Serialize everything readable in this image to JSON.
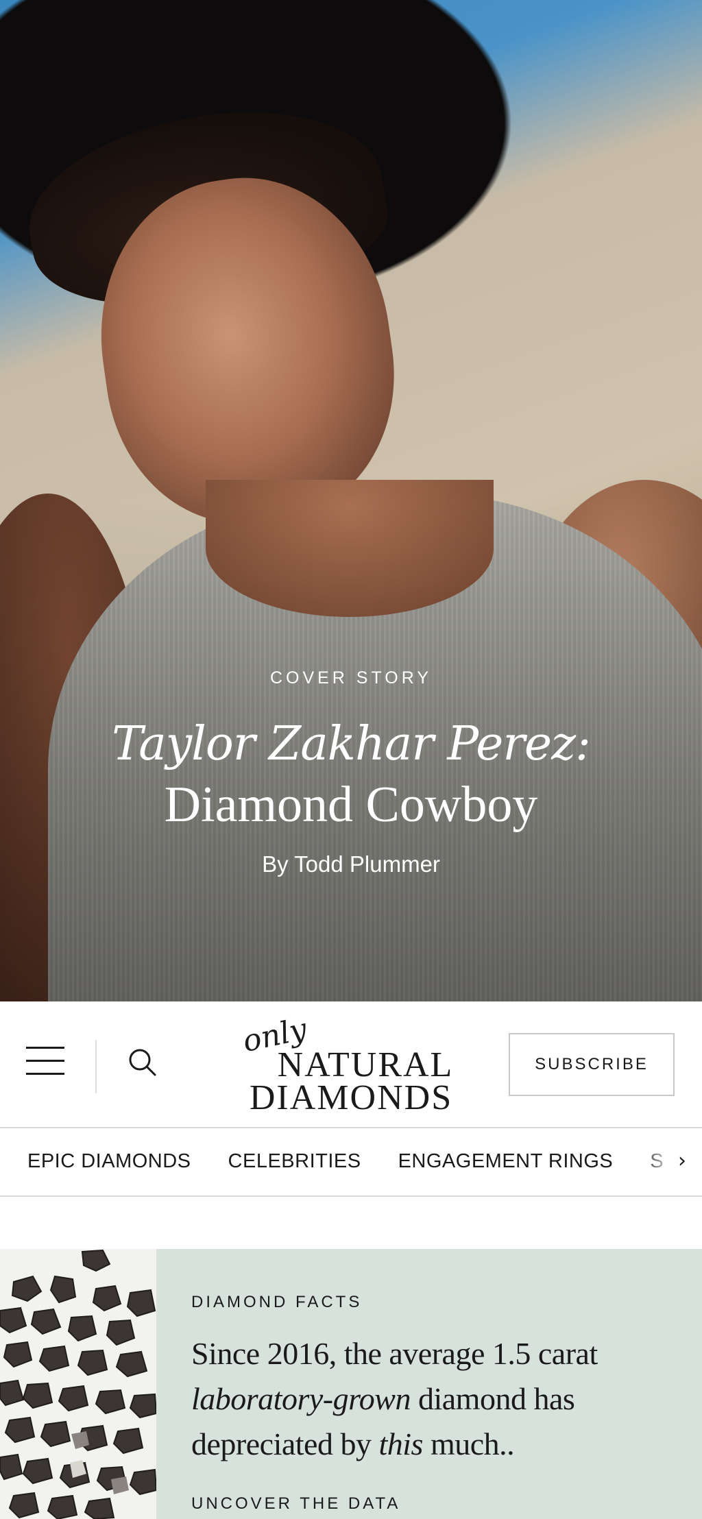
{
  "hero": {
    "kicker": "COVER STORY",
    "title_line1": "Taylor Zakhar Perez:",
    "title_line2": "Diamond Cowboy",
    "byline": "By Todd Plummer"
  },
  "header": {
    "logo_script": "only",
    "logo_line1": "NATURAL",
    "logo_line2": "DIAMONDS",
    "subscribe_label": "SUBSCRIBE"
  },
  "nav": {
    "items": [
      {
        "label": "EPIC DIAMONDS"
      },
      {
        "label": "CELEBRITIES"
      },
      {
        "label": "ENGAGEMENT RINGS"
      },
      {
        "label": "S"
      }
    ]
  },
  "card": {
    "kicker": "DIAMOND FACTS",
    "headline_part1": "Since 2016, the average 1.5 carat ",
    "headline_italic1": "laboratory-grown",
    "headline_part2": " diamond has depreciated by ",
    "headline_italic2": "this",
    "headline_part3": " much..",
    "cta": "UNCOVER THE DATA"
  },
  "icons": [
    "menu-icon",
    "search-icon",
    "chevron-right-icon"
  ]
}
